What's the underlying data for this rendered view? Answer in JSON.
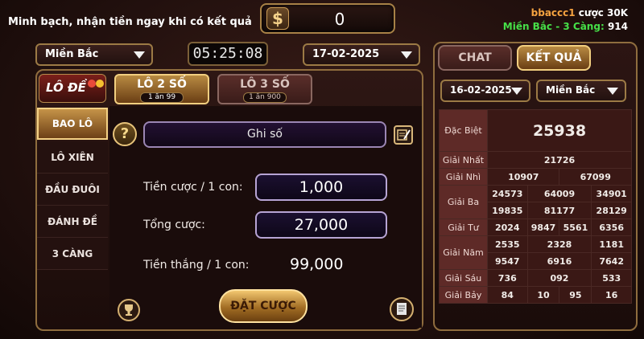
{
  "header": {
    "tagline": "Minh bạch, nhận tiền ngay khi có kết quả",
    "balance_symbol": "$",
    "balance": "0",
    "user_line": "bbaccc1 cược 30K",
    "user_name": "bbaccc1",
    "user_action": "cược",
    "user_amount": "30K",
    "region_line_prefix": "Miền Bắc - 3 Càng:",
    "region_line_value": "914"
  },
  "controls": {
    "region_select": "Miền Bắc",
    "timer": "05:25:08",
    "date_select": "17-02-2025"
  },
  "game": {
    "logo": "LÔ ĐỀ",
    "tabs": [
      {
        "label": "LÔ 2 SỐ",
        "sub": "1 ăn 99",
        "active": true
      },
      {
        "label": "LÔ 3 SỐ",
        "sub": "1 ăn 900",
        "active": false
      }
    ],
    "sidebar": [
      "BAO LÔ",
      "LÔ XIÊN",
      "ĐẦU ĐUÔI",
      "ĐÁNH ĐỀ",
      "3 CÀNG"
    ],
    "help_symbol": "?",
    "number_placeholder": "Ghi số",
    "bet_per_label": "Tiền cược / 1 con:",
    "bet_per_value": "1,000",
    "total_label": "Tổng cược:",
    "total_value": "27,000",
    "win_label": "Tiền thắng / 1 con:",
    "win_value": "99,000",
    "bet_button": "ĐẶT CƯỢC"
  },
  "results": {
    "tab_chat": "CHAT",
    "tab_results": "KẾT QUẢ",
    "date": "16-02-2025",
    "region": "Miền Bắc",
    "rows": [
      {
        "label": "Đặc Biệt",
        "values": [
          [
            "25938"
          ]
        ]
      },
      {
        "label": "Giải Nhất",
        "values": [
          [
            "21726"
          ]
        ]
      },
      {
        "label": "Giải Nhì",
        "values": [
          [
            "10907",
            "67099"
          ]
        ]
      },
      {
        "label": "Giải Ba",
        "values": [
          [
            "24573",
            "64009",
            "34901"
          ],
          [
            "19835",
            "81177",
            "28129"
          ]
        ]
      },
      {
        "label": "Giải Tư",
        "values": [
          [
            "2024",
            "9847",
            "5561",
            "6356"
          ]
        ]
      },
      {
        "label": "Giải Năm",
        "values": [
          [
            "2535",
            "2328",
            "1181"
          ],
          [
            "9547",
            "6916",
            "7642"
          ]
        ]
      },
      {
        "label": "Giải Sáu",
        "values": [
          [
            "736",
            "092",
            "533"
          ]
        ]
      },
      {
        "label": "Giải Bảy",
        "values": [
          [
            "84",
            "10",
            "95",
            "16"
          ]
        ]
      }
    ]
  },
  "colors": {
    "gold": "#b08a4a",
    "accent_orange": "#f5a340",
    "user_name": "#f5a340",
    "region_line": "#46e048"
  },
  "icons": [
    "dollar-icon",
    "help-icon",
    "edit-icon",
    "trophy-icon",
    "receipt-icon",
    "caret-down-icon"
  ]
}
